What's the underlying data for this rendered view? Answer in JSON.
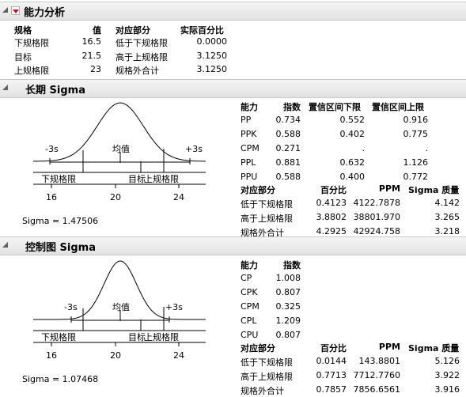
{
  "capability": {
    "title": "能力分析",
    "headers": [
      "规格",
      "值",
      "对应部分",
      "实际百分比"
    ],
    "rows": [
      [
        "下规格限",
        "16.5",
        "低于下规格限",
        "0.0000"
      ],
      [
        "目标",
        "21.5",
        "高于上规格限",
        "3.1250"
      ],
      [
        "上规格限",
        "23",
        "规格外合计",
        "3.1250"
      ]
    ]
  },
  "long_term": {
    "title": "长期 Sigma",
    "sigma_text": "Sigma = 1.47506",
    "plot": {
      "neg3s": "-3s",
      "mean": "均值",
      "pos3s": "+3s",
      "lsl": "下规格限",
      "target": "目标",
      "usl": "上规格限",
      "ticks": [
        "16",
        "20",
        "24"
      ]
    },
    "index_headers": [
      "能力",
      "指数",
      "置信区间下限",
      "置信区间上限"
    ],
    "index_rows": [
      [
        "PP",
        "0.734",
        "0.552",
        "0.916"
      ],
      [
        "PPK",
        "0.588",
        "0.402",
        "0.775"
      ],
      [
        "CPM",
        "0.271",
        ".",
        "."
      ],
      [
        "PPL",
        "0.881",
        "0.632",
        "1.126"
      ],
      [
        "PPU",
        "0.588",
        "0.400",
        "0.772"
      ]
    ],
    "perf_headers": [
      "对应部分",
      "百分比",
      "PPM",
      "Sigma 质量"
    ],
    "perf_rows": [
      [
        "低于下规格限",
        "0.4123",
        "4122.7878",
        "4.142"
      ],
      [
        "高于上规格限",
        "3.8802",
        "38801.970",
        "3.265"
      ],
      [
        "规格外合计",
        "4.2925",
        "42924.758",
        "3.218"
      ]
    ]
  },
  "control": {
    "title": "控制图 Sigma",
    "sigma_text": "Sigma = 1.07468",
    "plot": {
      "neg3s": "-3s",
      "mean": "均值",
      "pos3s": "+3s",
      "lsl": "下规格限",
      "target": "目标",
      "usl": "上规格限",
      "ticks": [
        "16",
        "20",
        "24"
      ]
    },
    "index_headers": [
      "能力",
      "指数"
    ],
    "index_rows": [
      [
        "CP",
        "1.008"
      ],
      [
        "CPK",
        "0.807"
      ],
      [
        "CPM",
        "0.325"
      ],
      [
        "CPL",
        "1.209"
      ],
      [
        "CPU",
        "0.807"
      ]
    ],
    "perf_headers": [
      "对应部分",
      "百分比",
      "PPM",
      "Sigma 质量"
    ],
    "perf_rows": [
      [
        "低于下规格限",
        "0.0144",
        "143.8801",
        "5.126"
      ],
      [
        "高于上规格限",
        "0.7713",
        "7712.7760",
        "3.922"
      ],
      [
        "规格外合计",
        "0.7857",
        "7856.6561",
        "3.916"
      ]
    ]
  }
}
